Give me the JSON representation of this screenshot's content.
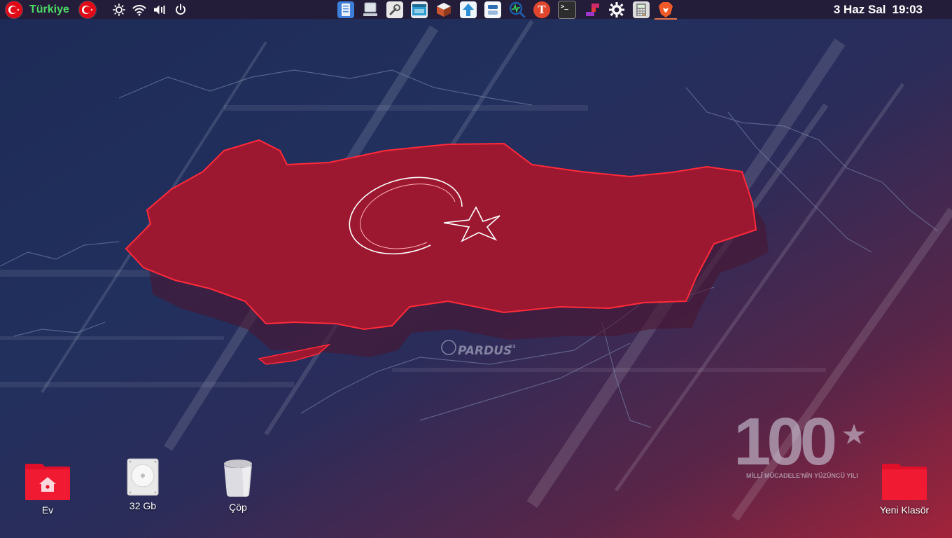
{
  "panel": {
    "country_label": "Türkiye",
    "tray_icons": [
      "brightness-icon",
      "wifi-icon",
      "volume-icon",
      "power-icon"
    ],
    "launcher_apps": [
      {
        "name": "file-manager-app",
        "color": "#3d7fd9"
      },
      {
        "name": "computer-app",
        "color": "#6c7a8a"
      },
      {
        "name": "settings-tool-app",
        "color": "#8f8f8f"
      },
      {
        "name": "window-app",
        "color": "#2a9ccf"
      },
      {
        "name": "package-installer-app",
        "color": "#c9562f"
      },
      {
        "name": "updater-app",
        "color": "#2c8fd6"
      },
      {
        "name": "control-app",
        "color": "#2f6eb5"
      },
      {
        "name": "system-monitor-app",
        "color": "#1d5ca8"
      },
      {
        "name": "font-app",
        "color": "#e0452d"
      },
      {
        "name": "terminal-app",
        "color": "#2d2d2d"
      },
      {
        "name": "tetris-app",
        "color": "#cf2a6a"
      },
      {
        "name": "gear-app",
        "color": "#ffffff"
      },
      {
        "name": "calculator-app",
        "color": "#8a8a8a"
      },
      {
        "name": "brave-browser-app",
        "color": "#f05a28"
      }
    ],
    "date": "3 Haz Sal",
    "time": "19:03"
  },
  "wallpaper": {
    "brand": "PARDUS",
    "brand_superscript": "23",
    "centennial_number": "100",
    "centennial_text": "MİLLÎ MÜCADELE'NİN YÜZÜNCÜ YILI"
  },
  "desktop": {
    "icons": [
      {
        "label": "Ev",
        "type": "home-folder"
      },
      {
        "label": "32 Gb",
        "type": "drive"
      },
      {
        "label": "Çöp",
        "type": "trash"
      },
      {
        "label": "Yeni Klasör",
        "type": "folder"
      }
    ]
  },
  "colors": {
    "panel_bg": "#241d3a",
    "accent_red": "#e30a17",
    "country_label": "#4cd964"
  }
}
